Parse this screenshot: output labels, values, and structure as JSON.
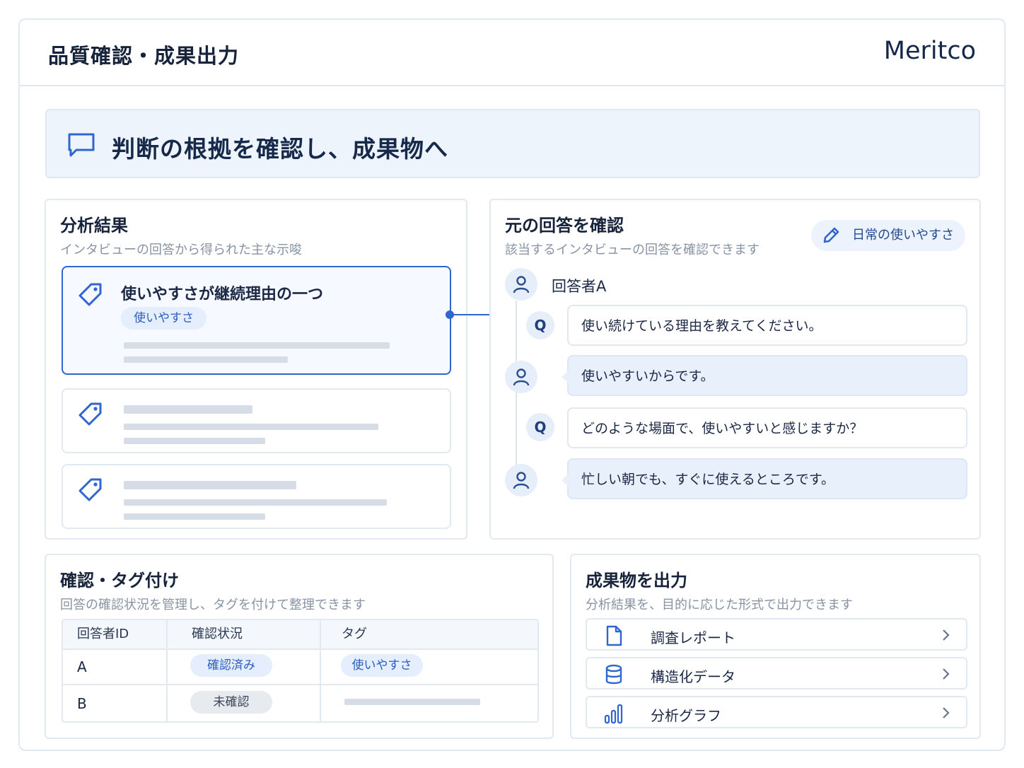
{
  "header": {
    "title": "品質確認・成果出力",
    "brand": "Meritco"
  },
  "banner": {
    "text": "判断の根拠を確認し、成果物へ",
    "icon": "chat-bubble-icon"
  },
  "analysis": {
    "title": "分析結果",
    "subtitle": "インタビューの回答から得られた主な示唆",
    "cards": [
      {
        "title": "使いやすさが継続理由の一つ",
        "tag": "使いやすさ",
        "icon": "tag-icon"
      }
    ]
  },
  "answers": {
    "title": "元の回答を確認",
    "subtitle": "該当するインタビューの回答を確認できます",
    "filter_label": "日常の使いやすさ",
    "respondent": "回答者A",
    "q_badge": "Q",
    "messages": [
      {
        "type": "question",
        "text": "使い続けている理由を教えてください。"
      },
      {
        "type": "answer",
        "text": "使いやすいからです。"
      },
      {
        "type": "question",
        "text": "どのような場面で、使いやすいと感じますか？"
      },
      {
        "type": "answer",
        "text": "忙しい朝でも、すぐに使えるところです。"
      }
    ]
  },
  "tagging": {
    "title": "確認・タグ付け",
    "subtitle": "回答の確認状況を管理し、タグを付けて整理できます",
    "columns": [
      "回答者ID",
      "確認状況",
      "タグ"
    ],
    "rows": [
      {
        "id": "A",
        "status": "確認済み",
        "tag": "使いやすさ"
      },
      {
        "id": "B",
        "status": "未確認",
        "tag": ""
      }
    ]
  },
  "output": {
    "title": "成果物を出力",
    "subtitle": "分析結果を、目的に応じた形式で出力できます",
    "items": [
      {
        "label": "調査レポート",
        "icon": "document-icon"
      },
      {
        "label": "構造化データ",
        "icon": "database-icon"
      },
      {
        "label": "分析グラフ",
        "icon": "bar-chart-icon"
      }
    ]
  },
  "colors": {
    "accent": "#2f66d0",
    "chip_bg": "#e4eefc",
    "panel_border": "#e2e9f2",
    "answer_bg": "#e8f0fb"
  }
}
